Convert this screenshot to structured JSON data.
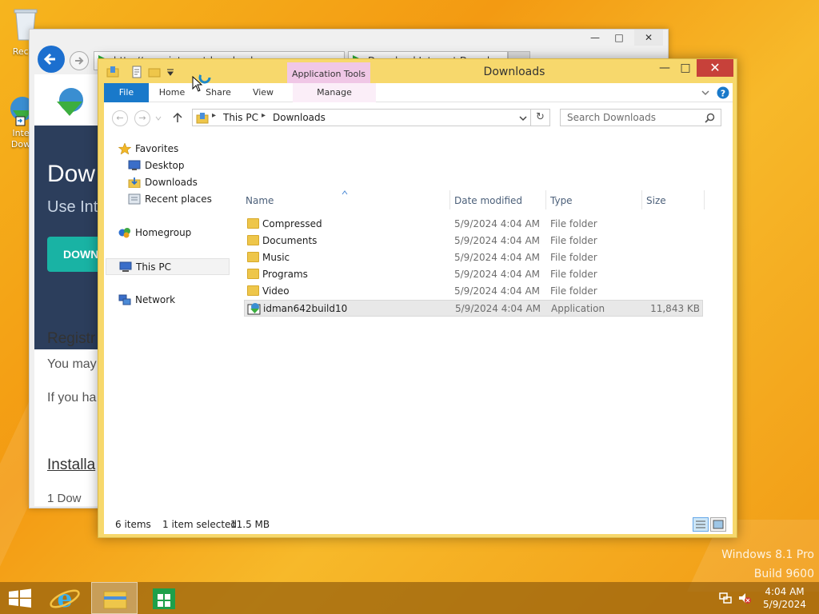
{
  "desktop": {
    "icons": [
      {
        "label": "Recyc"
      },
      {
        "label": "Inte\nDow"
      }
    ],
    "watermark": {
      "line1": "Windows 8.1 Pro",
      "line2": "Build 9600"
    }
  },
  "ie": {
    "address": "http://www.internetdownloadmanager...",
    "tab_title": "Download Internet Downlo...",
    "hero_title": "Dow",
    "hero_sub": "Use Inte",
    "hero_button": "DOWN",
    "section1_title": "Registr",
    "section1_line1": "You may",
    "section1_line2": "If you ha",
    "section2_title": "Installa",
    "section2_item": "1   Dow"
  },
  "explorer": {
    "title": "Downloads",
    "context_tab": "Application Tools",
    "ribbon_tabs": [
      "File",
      "Home",
      "Share",
      "View",
      "Manage"
    ],
    "breadcrumb": [
      "This PC",
      "Downloads"
    ],
    "search_placeholder": "Search Downloads",
    "nav": {
      "favorites": "Favorites",
      "desktop": "Desktop",
      "downloads": "Downloads",
      "recent": "Recent places",
      "homegroup": "Homegroup",
      "thispc": "This PC",
      "network": "Network"
    },
    "columns": {
      "name": "Name",
      "date": "Date modified",
      "type": "Type",
      "size": "Size"
    },
    "files": [
      {
        "name": "Compressed",
        "date": "5/9/2024 4:04 AM",
        "type": "File folder",
        "size": "",
        "icon": "folder-icon"
      },
      {
        "name": "Documents",
        "date": "5/9/2024 4:04 AM",
        "type": "File folder",
        "size": "",
        "icon": "folder-icon"
      },
      {
        "name": "Music",
        "date": "5/9/2024 4:04 AM",
        "type": "File folder",
        "size": "",
        "icon": "folder-icon"
      },
      {
        "name": "Programs",
        "date": "5/9/2024 4:04 AM",
        "type": "File folder",
        "size": "",
        "icon": "folder-icon"
      },
      {
        "name": "Video",
        "date": "5/9/2024 4:04 AM",
        "type": "File folder",
        "size": "",
        "icon": "folder-icon"
      },
      {
        "name": "idman642build10",
        "date": "5/9/2024 4:04 AM",
        "type": "Application",
        "size": "11,843 KB",
        "icon": "application-icon"
      }
    ],
    "status": {
      "items": "6 items",
      "selected": "1 item selected",
      "size": "11.5 MB"
    }
  },
  "taskbar": {
    "time": "4:04 AM",
    "date": "5/9/2024"
  },
  "colors": {
    "accent": "#1979ca",
    "title_bar": "#f7d86c",
    "context_tab": "#f0c7e6",
    "close_button": "#c7413a",
    "wallpaper": "#f5a719"
  }
}
